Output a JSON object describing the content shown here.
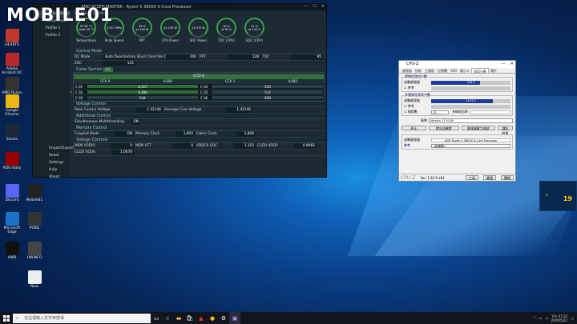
{
  "watermark": "MOBILE01",
  "desktop": {
    "icons": [
      {
        "label": "HEARTS",
        "color": "#c0392b"
      },
      {
        "label": "Adobe Acrobat DC",
        "color": "#b52a2a"
      },
      {
        "label": "AMD Ryzen Master",
        "color": "#333"
      },
      {
        "label": "Google Chrome",
        "color": "#e9b616"
      },
      {
        "label": "Steam",
        "color": "#1b2838"
      },
      {
        "label": "ROG Rally",
        "color": "#900"
      },
      {
        "label": "Discord",
        "color": "#5865f2"
      },
      {
        "label": "Mobile01",
        "color": "#222"
      },
      {
        "label": "Microsoft Edge",
        "color": "#1a73c8"
      },
      {
        "label": "PUBG",
        "color": "#333"
      },
      {
        "label": "AMD",
        "color": "#111"
      },
      {
        "label": "HWiNFO",
        "color": "#444"
      },
      {
        "label": "New",
        "color": "#eee"
      }
    ]
  },
  "ryzen_master": {
    "title": "AMD RYZEN MASTER · Ryzen 5 3600X 6-Core Processor",
    "header": "Profile & Control",
    "sidebar": [
      "Control Mode",
      "Game Mode",
      "Profile 1",
      "Profile 2"
    ],
    "sidebar_bottom": [
      "Import/Export",
      "Reset",
      "Settings",
      "Help",
      "About"
    ],
    "gauges": [
      {
        "value": "57.65 °C\nLimit 95 °C",
        "label": "Temperature"
      },
      {
        "value": "4,317 MHz",
        "label": "Peak Speed"
      },
      {
        "value": "36 %\nof 128 W",
        "label": "PPT"
      },
      {
        "value": "24.278 W",
        "label": "CPU Power"
      },
      {
        "value": "13.070 W",
        "label": "SOC Power"
      },
      {
        "value": "10 %\nof 95 A",
        "label": "TDC (CPU)"
      },
      {
        "value": "32 %\nof 125 A",
        "label": "EDC (CPU)"
      }
    ],
    "sections": {
      "control": "Control Mode",
      "cores": "Cores Section",
      "voltage": "Voltage Control",
      "additional": "Additional Control",
      "memory": "Memory Control",
      "memvolt": "Voltage Controls"
    },
    "control_rows": [
      [
        "OC Mode",
        "Auto Overclocking",
        "Boost Override CPU",
        "200",
        "PPT",
        "128",
        "TDC",
        "95"
      ],
      [
        "EDC",
        "125",
        "",
        "",
        "",
        "",
        "",
        ""
      ]
    ],
    "cores_toggle": "OC",
    "ccd_title": "CCD 0",
    "ccx": [
      "CCX 0",
      "4,600",
      "CCX 1",
      "4,600"
    ],
    "core_rows": [
      [
        "C 01",
        "4,317",
        "C 04",
        "543"
      ],
      [
        "C 02",
        "4,306",
        "C 05",
        "512"
      ],
      [
        "C 03",
        "544",
        "C 06",
        "630"
      ]
    ],
    "voltage_rows": [
      [
        "Peak Core(s) Voltage",
        "1.42146",
        "Average Core Voltage",
        "1.42146"
      ]
    ],
    "additional_rows": [
      [
        "Simultaneous Multithreading",
        "ON"
      ]
    ],
    "memory_rows": [
      [
        "Coupled Mode",
        "ON",
        "Memory Clock",
        "1,800",
        "Fabric Clock",
        "1,800"
      ]
    ],
    "memvolt_rows": [
      [
        "MEM VDDIO",
        "0",
        "MEM VTT",
        "0",
        "VDDCR SOC",
        "1.103",
        "CLDO VDDP",
        "0.9082"
      ],
      [
        "CLDO VDDG",
        "1.0078",
        "",
        "",
        "",
        "",
        "",
        ""
      ]
    ]
  },
  "cpuz": {
    "title": "CPU-Z",
    "tabs": [
      "處理器",
      "快取",
      "主機板",
      "記憶體",
      "SPD",
      "顯示卡",
      "測試分數",
      "關於"
    ],
    "single": {
      "title": "單線程測試分數",
      "this": "這顆處理器",
      "this_val": "528.9",
      "ref": "參考",
      "single_fill": 0.62
    },
    "multi": {
      "title": "多重線程測試分數",
      "this": "這顆處理器",
      "this_val": "4191.5",
      "ref": "參考",
      "threads_label": "線程數",
      "threads": "12",
      "ratio": "多線程倍率",
      "multi_fill": 0.78
    },
    "bench_label": "基準",
    "bench_value": "Version 17.01.64",
    "buttons": [
      "停止",
      "提交及驗證",
      "處理器壓力測試",
      "儲存結果"
    ],
    "this_cpu_label": "這顆處理器",
    "this_cpu": "AMD Ryzen 5 3600X 6-Core Processor",
    "ref_label": "參考",
    "ref_value": "<請選擇>",
    "footer": {
      "brand": "CPU-Z",
      "ver": "Ver. 1.92.0.x64",
      "tools": "工具",
      "validate": "驗證",
      "close": "關閉"
    }
  },
  "widget": {
    "value": "19"
  },
  "taskbar": {
    "search_placeholder": "在這裡輸入文字來搜尋",
    "time": "下午 07:22",
    "date": "2020/5/22"
  }
}
